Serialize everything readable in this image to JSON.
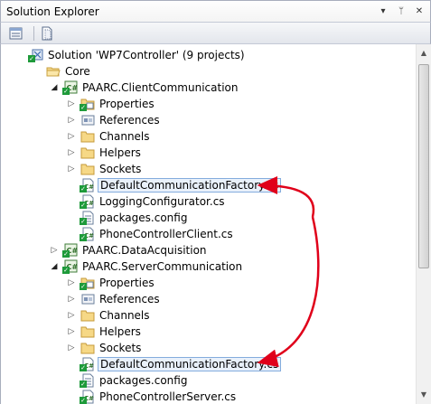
{
  "window": {
    "title": "Solution Explorer"
  },
  "title_buttons": [
    {
      "name": "dropdown-icon",
      "glyph": "▾"
    },
    {
      "name": "pin-icon",
      "glyph": "ᛘ"
    },
    {
      "name": "close-icon",
      "glyph": "✕"
    }
  ],
  "toolbar": {
    "properties_icon": "properties-icon",
    "show-all-files_icon": "show-all-files-icon"
  },
  "colors": {
    "selection_border": "#84acdd",
    "arrow": "#e0001a",
    "check": "#1e9a3a"
  },
  "tree": [
    {
      "label": "Solution 'WP7Controller' (9 projects)",
      "icon": "solution-icon",
      "level": 0,
      "expander": "none",
      "check": true
    },
    {
      "label": "Core",
      "icon": "folder-open-icon",
      "level": 1,
      "expander": "none",
      "check": false
    },
    {
      "label": "PAARC.ClientCommunication",
      "icon": "csharp-project-icon",
      "level": 2,
      "expander": "open",
      "check": true
    },
    {
      "label": "Properties",
      "icon": "properties-folder-icon",
      "level": 3,
      "expander": "closed",
      "check": true
    },
    {
      "label": "References",
      "icon": "references-icon",
      "level": 3,
      "expander": "closed",
      "check": false
    },
    {
      "label": "Channels",
      "icon": "folder-icon",
      "level": 3,
      "expander": "closed",
      "check": false
    },
    {
      "label": "Helpers",
      "icon": "folder-icon",
      "level": 3,
      "expander": "closed",
      "check": false
    },
    {
      "label": "Sockets",
      "icon": "folder-icon",
      "level": 3,
      "expander": "closed",
      "check": false
    },
    {
      "label": "DefaultCommunicationFactory.cs",
      "icon": "csharp-file-icon",
      "level": 3,
      "expander": "none",
      "check": true,
      "selected": true
    },
    {
      "label": "LoggingConfigurator.cs",
      "icon": "csharp-file-icon",
      "level": 3,
      "expander": "none",
      "check": true
    },
    {
      "label": "packages.config",
      "icon": "config-file-icon",
      "level": 3,
      "expander": "none",
      "check": true
    },
    {
      "label": "PhoneControllerClient.cs",
      "icon": "csharp-file-icon",
      "level": 3,
      "expander": "none",
      "check": true
    },
    {
      "label": "PAARC.DataAcquisition",
      "icon": "csharp-project-icon",
      "level": 2,
      "expander": "closed",
      "check": true
    },
    {
      "label": "PAARC.ServerCommunication",
      "icon": "csharp-project-icon",
      "level": 2,
      "expander": "open",
      "check": true
    },
    {
      "label": "Properties",
      "icon": "properties-folder-icon",
      "level": 3,
      "expander": "closed",
      "check": true
    },
    {
      "label": "References",
      "icon": "references-icon",
      "level": 3,
      "expander": "closed",
      "check": false
    },
    {
      "label": "Channels",
      "icon": "folder-icon",
      "level": 3,
      "expander": "closed",
      "check": false
    },
    {
      "label": "Helpers",
      "icon": "folder-icon",
      "level": 3,
      "expander": "closed",
      "check": false
    },
    {
      "label": "Sockets",
      "icon": "folder-icon",
      "level": 3,
      "expander": "closed",
      "check": false
    },
    {
      "label": "DefaultCommunicationFactory.cs",
      "icon": "csharp-file-icon",
      "level": 3,
      "expander": "none",
      "check": true,
      "selected": true
    },
    {
      "label": "packages.config",
      "icon": "config-file-icon",
      "level": 3,
      "expander": "none",
      "check": true
    },
    {
      "label": "PhoneControllerServer.cs",
      "icon": "csharp-file-icon",
      "level": 3,
      "expander": "none",
      "check": true
    }
  ]
}
